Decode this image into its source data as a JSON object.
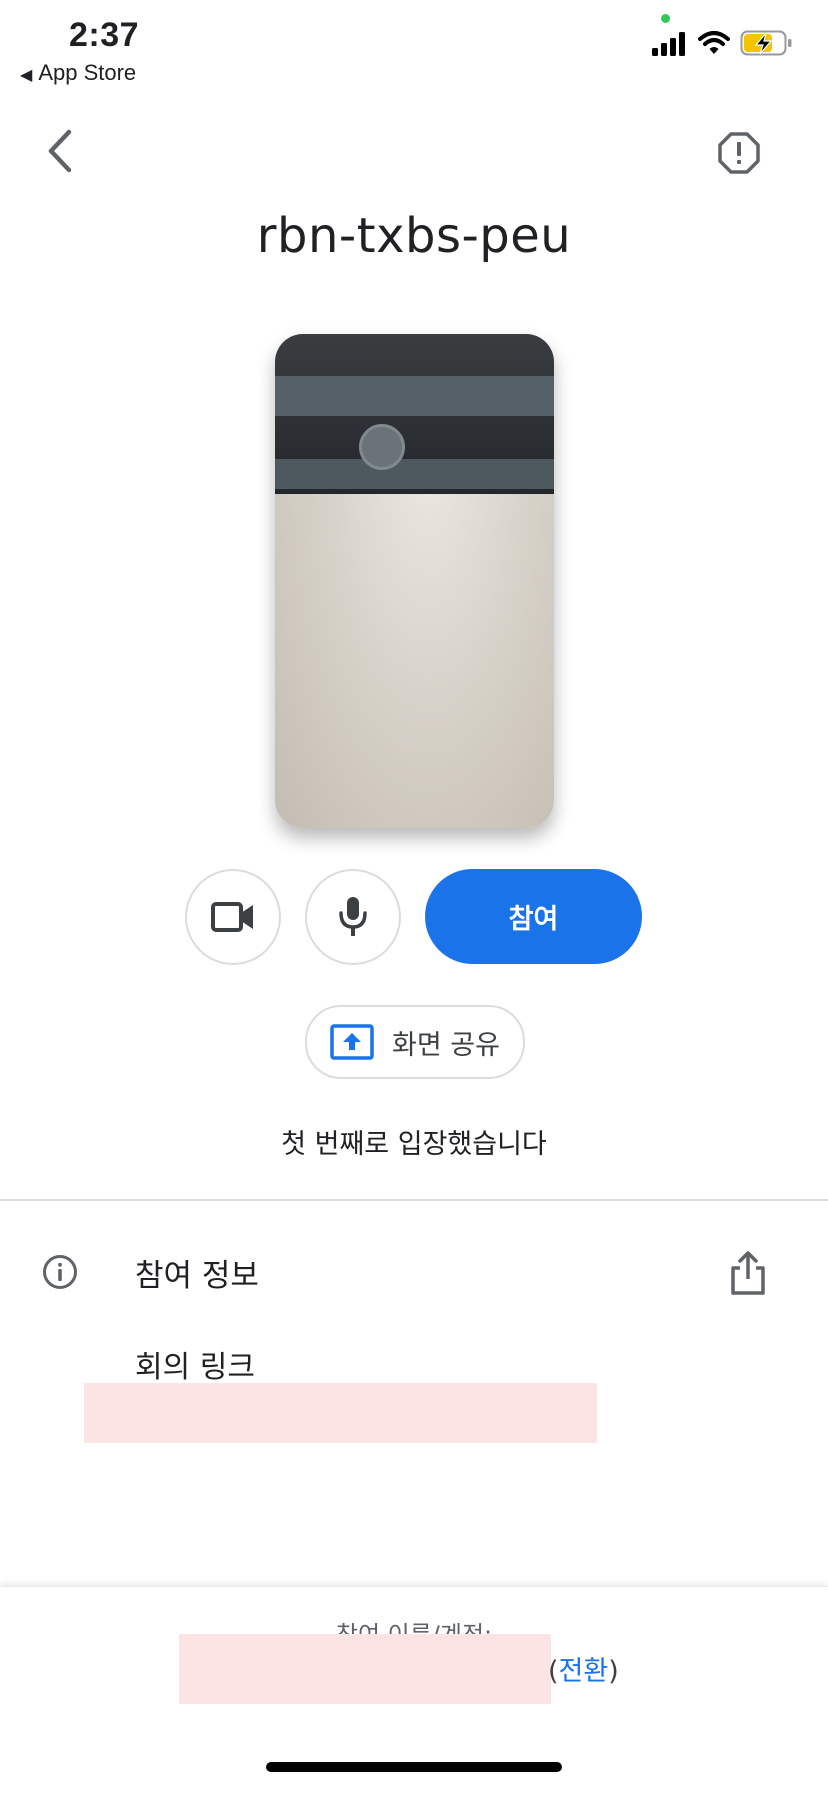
{
  "status_bar": {
    "time": "2:37",
    "back_app": "App Store",
    "back_arrow": "◀"
  },
  "header": {
    "back_icon": "chevron-left-icon",
    "report_icon": "report-issue-icon"
  },
  "meeting": {
    "code": "rbn-txbs-peu"
  },
  "controls": {
    "camera_icon": "video-camera-icon",
    "mic_icon": "microphone-icon",
    "join_label": "참여",
    "share_screen_label": "화면 공유"
  },
  "status_message": "첫 번째로 입장했습니다",
  "join_info": {
    "title": "참여 정보",
    "meeting_link_label": "회의 링크"
  },
  "footer": {
    "account_label": "참여 이름/계정:",
    "switch_open": "(",
    "switch_label": "전환",
    "switch_close": ")"
  },
  "colors": {
    "accent": "#1a73e8",
    "text": "#202124",
    "border": "#dadce0",
    "redaction": "#fde4e4"
  }
}
